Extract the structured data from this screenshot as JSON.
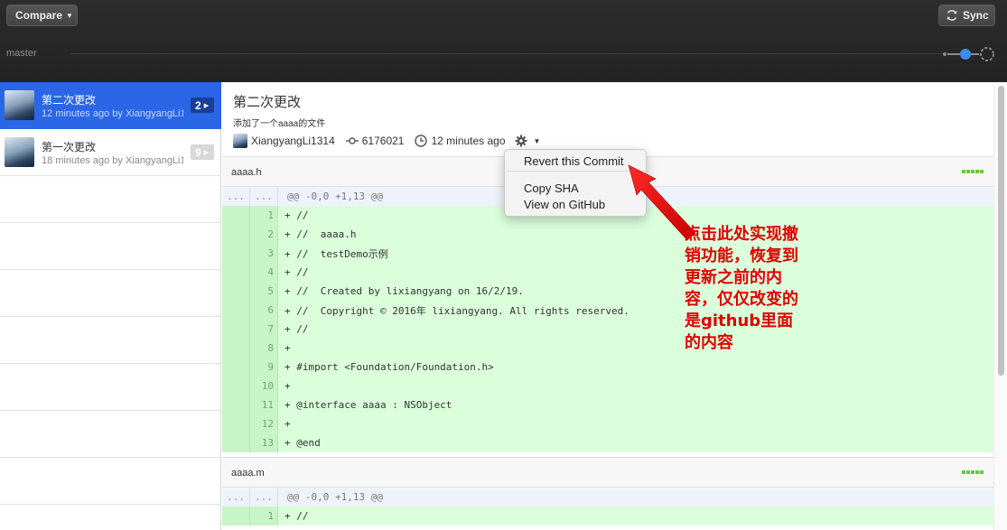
{
  "toolbar": {
    "compare_label": "Compare",
    "sync_label": "Sync",
    "branch": "master",
    "icons": {
      "compare_caret": "chevron-down-icon",
      "sync": "sync-icon"
    }
  },
  "sidebar": {
    "commits": [
      {
        "title": "第二次更改",
        "meta": "12 minutes ago by XiangyangLi1314",
        "count": "2",
        "selected": true
      },
      {
        "title": "第一次更改",
        "meta": "18 minutes ago by XiangyangLi1314",
        "count": "9",
        "selected": false
      }
    ]
  },
  "commit": {
    "title": "第二次更改",
    "description": "添加了一个aaaa的文件",
    "author": "XiangyangLi1314",
    "sha": "6176021",
    "time": "12 minutes ago"
  },
  "files": [
    {
      "name": "aaaa.h",
      "hunk": "@@ -0,0 +1,13 @@",
      "hunk_old": "...",
      "hunk_new": "...",
      "lines": [
        {
          "num": "1",
          "text": "+ //"
        },
        {
          "num": "2",
          "text": "+ //  aaaa.h"
        },
        {
          "num": "3",
          "text": "+ //  testDemo示例"
        },
        {
          "num": "4",
          "text": "+ //"
        },
        {
          "num": "5",
          "text": "+ //  Created by lixiangyang on 16/2/19."
        },
        {
          "num": "6",
          "text": "+ //  Copyright © 2016年 lixiangyang. All rights reserved."
        },
        {
          "num": "7",
          "text": "+ //"
        },
        {
          "num": "8",
          "text": "+"
        },
        {
          "num": "9",
          "text": "+ #import <Foundation/Foundation.h>"
        },
        {
          "num": "10",
          "text": "+"
        },
        {
          "num": "11",
          "text": "+ @interface aaaa : NSObject"
        },
        {
          "num": "12",
          "text": "+"
        },
        {
          "num": "13",
          "text": "+ @end"
        }
      ]
    },
    {
      "name": "aaaa.m",
      "hunk": "@@ -0,0 +1,13 @@",
      "hunk_old": "...",
      "hunk_new": "...",
      "lines": [
        {
          "num": "1",
          "text": "+ //"
        }
      ]
    }
  ],
  "context_menu": {
    "revert": "Revert this Commit",
    "copy_sha": "Copy SHA",
    "view_github": "View on GitHub"
  },
  "annotation": {
    "text": "点击此处实现撤\n销功能，恢复到\n更新之前的内\n容，仅仅改变的\n是github里面\n的内容",
    "color": "#e10000"
  },
  "colors": {
    "selected": "#2b66e6",
    "added_line": "#dbffdb",
    "diffstat": "#6cc644"
  }
}
